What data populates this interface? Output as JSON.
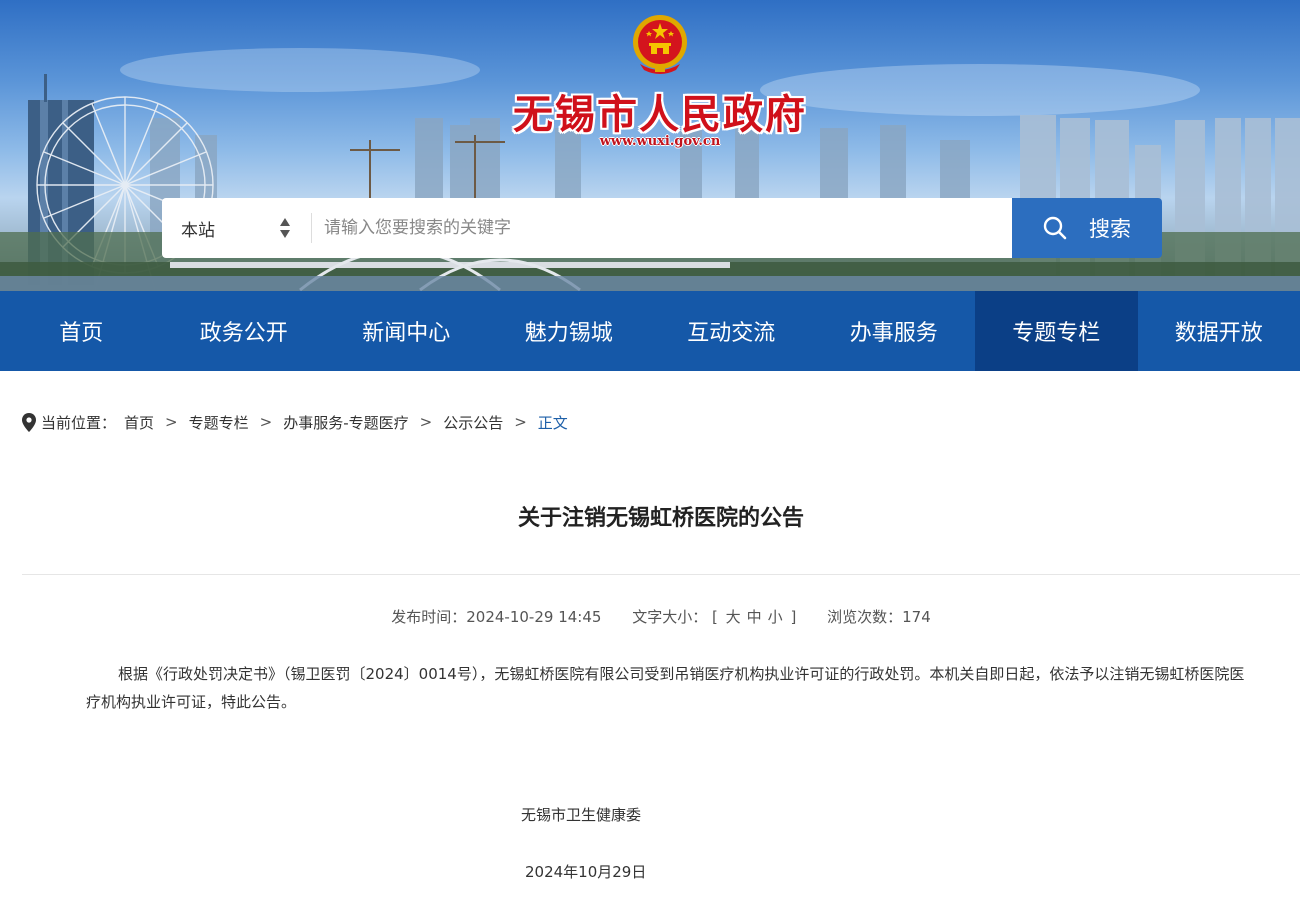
{
  "header": {
    "site_title": "无锡市人民政府",
    "site_url": "www.wuxi.gov.cn",
    "emblem_icon": "national-emblem-icon"
  },
  "search": {
    "scope_label": "本站",
    "placeholder": "请输入您要搜索的关键字",
    "button_label": "搜索"
  },
  "nav": {
    "items": [
      {
        "label": "首页"
      },
      {
        "label": "政务公开"
      },
      {
        "label": "新闻中心"
      },
      {
        "label": "魅力锡城"
      },
      {
        "label": "互动交流"
      },
      {
        "label": "办事服务"
      },
      {
        "label": "专题专栏"
      },
      {
        "label": "数据开放"
      }
    ],
    "active_index": 6
  },
  "breadcrumb": {
    "prefix": "当前位置：",
    "items": [
      "首页",
      "专题专栏",
      "办事服务-专题医疗",
      "公示公告",
      "正文"
    ],
    "separator": ">"
  },
  "article": {
    "title": "关于注销无锡虹桥医院的公告",
    "publish_label": "发布时间：",
    "publish_time": "2024-10-29 14:45",
    "font_size_label": "文字大小：",
    "font_size_open": "[",
    "font_sizes": [
      "大",
      "中",
      "小"
    ],
    "font_size_close": "]",
    "views_label": "浏览次数：",
    "views": "174",
    "body": "根据《行政处罚决定书》（锡卫医罚〔2024〕0014号），无锡虹桥医院有限公司受到吊销医疗机构执业许可证的行政处罚。本机关自即日起，依法予以注销无锡虹桥医院医疗机构执业许可证，特此公告。",
    "signer": "无锡市卫生健康委",
    "date": "2024年10月29日"
  },
  "colors": {
    "nav_bg": "#1558a8",
    "nav_active": "#0b3f86",
    "search_button": "#2c6ebf",
    "title_red": "#d0101a"
  }
}
